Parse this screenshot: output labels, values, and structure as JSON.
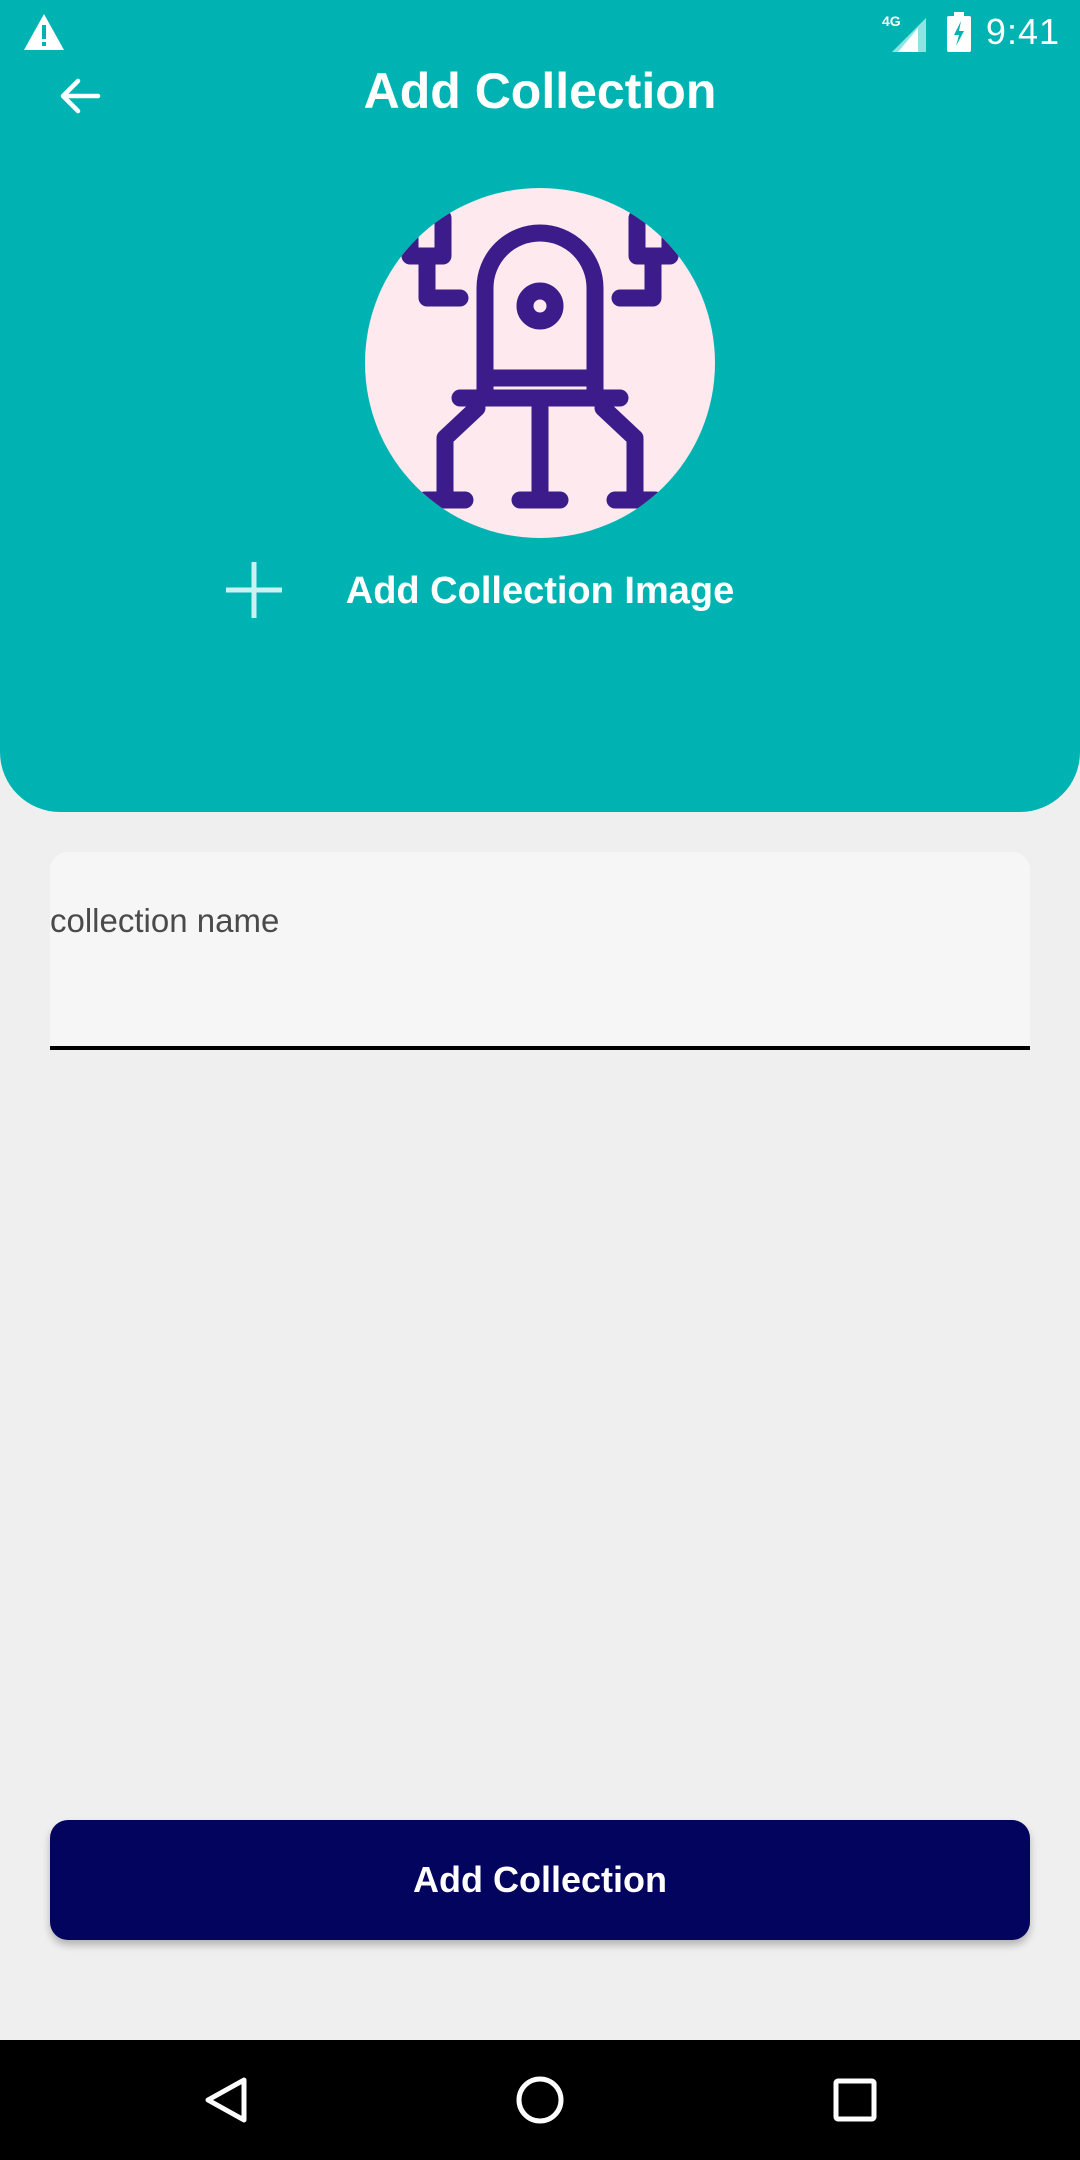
{
  "status_bar": {
    "network_label": "4G",
    "time": "9:41"
  },
  "header": {
    "title": "Add Collection",
    "back_icon": "arrow-left-icon",
    "add_image_label": "Add Collection Image",
    "add_image_icon": "plus-icon",
    "avatar_icon": "robot-icon"
  },
  "form": {
    "collection_name_placeholder": "collection name",
    "collection_name_value": ""
  },
  "actions": {
    "submit_label": "Add Collection"
  },
  "nav": {
    "back_icon": "nav-back-icon",
    "home_icon": "nav-home-icon",
    "recents_icon": "nav-recents-icon"
  },
  "colors": {
    "header_bg": "#00b3b3",
    "page_bg": "#efefef",
    "button_bg": "#03045e",
    "avatar_bg": "#fde9ee",
    "robot_stroke": "#3b1c8a"
  }
}
